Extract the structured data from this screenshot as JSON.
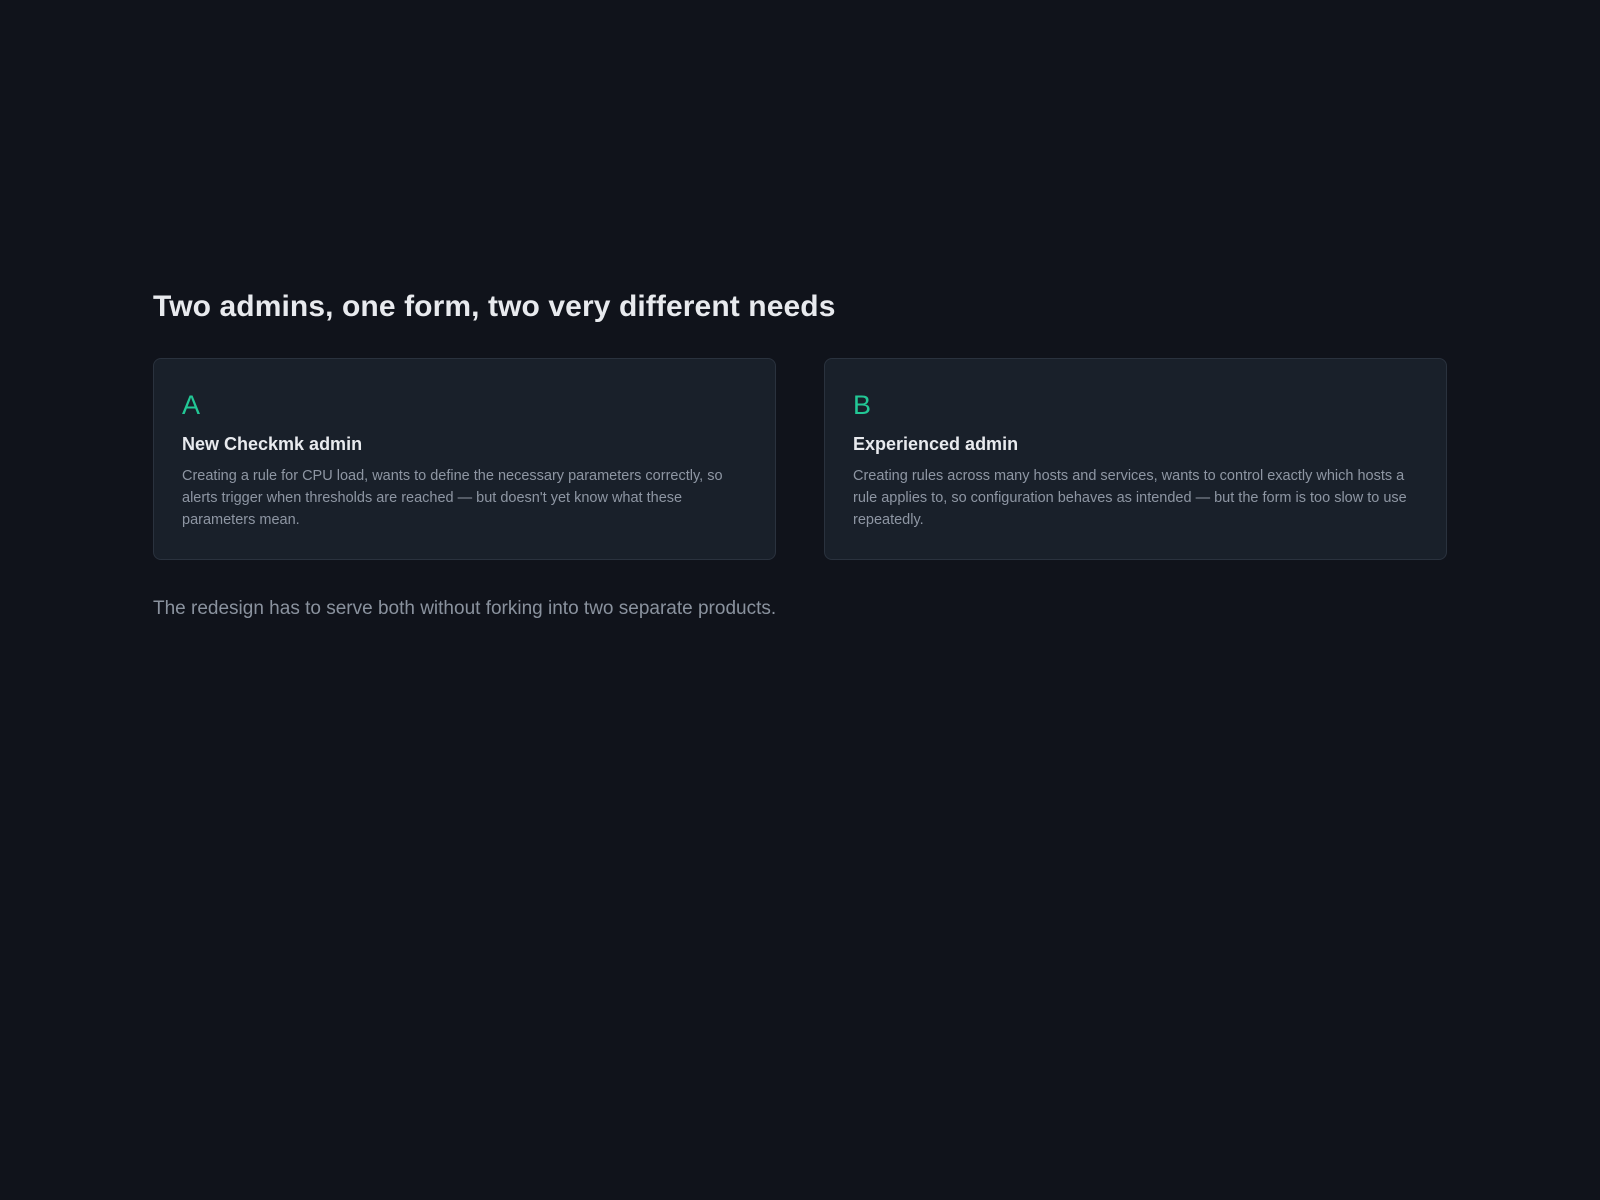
{
  "headline": "Two admins, one form, two very different needs",
  "cards": [
    {
      "letter": "A",
      "title": "New Checkmk admin",
      "text": "Creating a rule for CPU load, wants to define the necessary parameters correctly, so alerts trigger when thresholds are reached — but doesn't yet know what these parameters mean."
    },
    {
      "letter": "B",
      "title": "Experienced admin",
      "text": "Creating rules across many hosts and services, wants to control exactly which hosts a rule applies to, so configuration behaves as intended — but the form is too slow to use repeatedly."
    }
  ],
  "footer_note": "The redesign has to serve both without forking into two separate products.",
  "colors": {
    "background": "#10131b",
    "card_background": "#19202a",
    "accent": "#22c795",
    "heading_text": "#e8eaee",
    "muted_text": "#8e96a3"
  }
}
